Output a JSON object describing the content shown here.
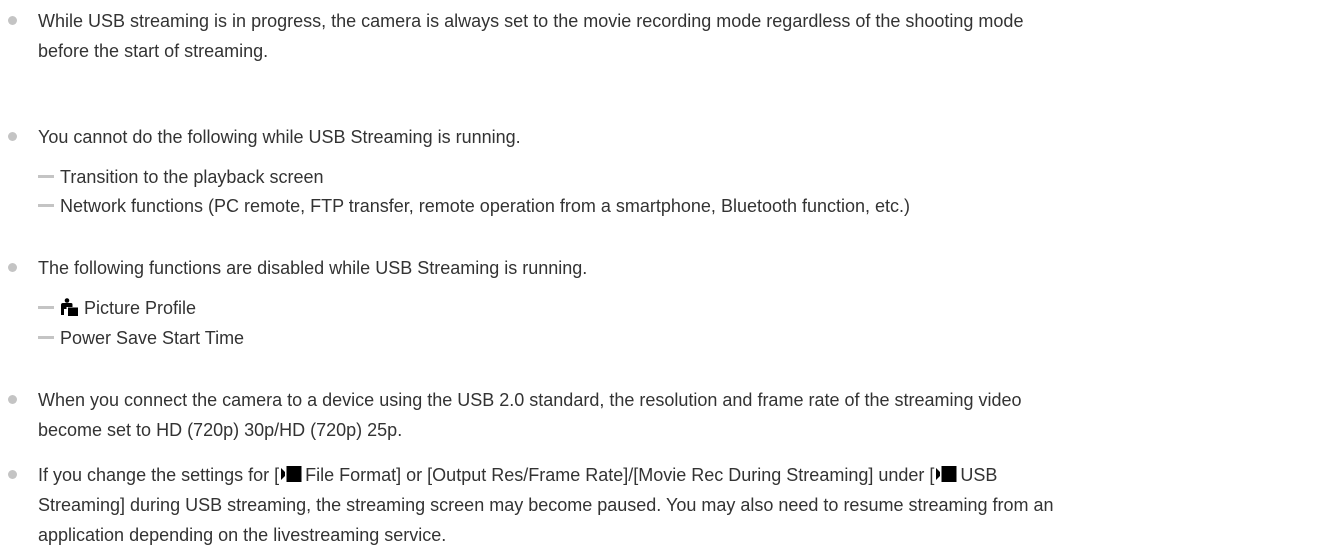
{
  "notes": {
    "note_1": {
      "text": "While USB streaming is in progress, the camera is always set to the movie recording mode regardless of the shooting mode\nbefore the start of streaming."
    },
    "note_2": {
      "text": "You cannot do the following while USB Streaming is running.",
      "items": [
        "Transition to the playback screen",
        "Network functions (PC remote, FTP transfer, remote operation from a smartphone, Bluetooth function, etc.)"
      ]
    },
    "note_3": {
      "text": "The following functions are disabled while USB Streaming is running.",
      "items": [
        {
          "icon": "picture-profile-icon",
          "label": "Picture Profile"
        },
        {
          "label": "Power Save Start Time"
        }
      ]
    },
    "note_4": {
      "text": "When you connect the camera to a device using the USB 2.0 standard, the resolution and frame rate of the streaming video\nbecome set to HD (720p) 30p/HD (720p) 25p."
    },
    "note_5": {
      "part1": "If you change the settings for [",
      "icon": "movie-icon",
      "part2": "File Format] or [Output Res/Frame Rate]/[Movie Rec During Streaming] under [",
      "part3": "USB",
      "part4": "\nStreaming] during USB streaming, the streaming screen may become paused. You may also need to resume streaming from an\napplication depending on the livestreaming service."
    }
  }
}
